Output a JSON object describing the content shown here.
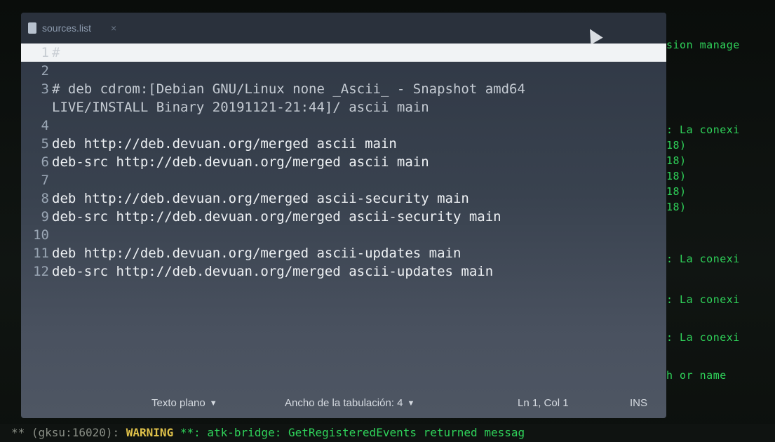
{
  "editor": {
    "tab": {
      "filename": "sources.list",
      "close": "×"
    },
    "lines": [
      {
        "num": "1",
        "text": "#"
      },
      {
        "num": "2",
        "text": ""
      },
      {
        "num": "3",
        "text": "# deb cdrom:[Debian GNU/Linux none _Ascii_ - Snapshot amd64",
        "wrap": "LIVE/INSTALL Binary 20191121-21:44]/ ascii main"
      },
      {
        "num": "4",
        "text": ""
      },
      {
        "num": "5",
        "text": "deb http://deb.devuan.org/merged ascii main"
      },
      {
        "num": "6",
        "text": "deb-src http://deb.devuan.org/merged ascii main"
      },
      {
        "num": "7",
        "text": ""
      },
      {
        "num": "8",
        "text": "deb http://deb.devuan.org/merged ascii-security main"
      },
      {
        "num": "9",
        "text": "deb-src http://deb.devuan.org/merged ascii-security main"
      },
      {
        "num": "10",
        "text": ""
      },
      {
        "num": "11",
        "text": "deb http://deb.devuan.org/merged ascii-updates main"
      },
      {
        "num": "12",
        "text": "deb-src http://deb.devuan.org/merged ascii-updates main"
      }
    ],
    "statusbar": {
      "language": "Texto plano",
      "tab_width": "Ancho de la tabulación: 4",
      "position": "Ln 1, Col 1",
      "mode": "INS"
    }
  },
  "terminal": {
    "lines": [
      "sion manage",
      ": La conexi",
      "18)",
      "18)",
      "18)",
      "18)",
      "18)",
      ": La conexi",
      ": La conexi",
      ": La conexi",
      "h or name"
    ],
    "bottom": {
      "prefix": "** (gksu:16020): ",
      "warning": "WARNING",
      "rest": " **: atk-bridge: GetRegisteredEvents returned messag"
    }
  }
}
